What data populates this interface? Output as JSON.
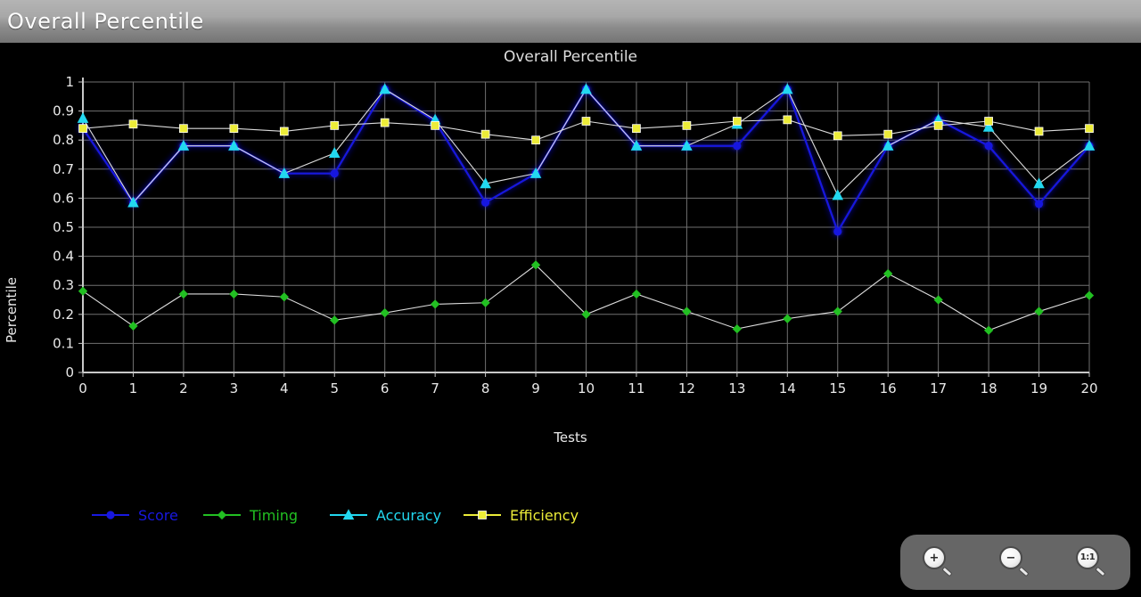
{
  "window": {
    "title": "Overall Percentile"
  },
  "chart_data": {
    "type": "line",
    "title": "Overall Percentile",
    "xlabel": "Tests",
    "ylabel": "Percentile",
    "grid": true,
    "legend_position": "bottom-left",
    "xlim": [
      0,
      20
    ],
    "ylim": [
      0,
      1
    ],
    "x": [
      0,
      1,
      2,
      3,
      4,
      5,
      6,
      7,
      8,
      9,
      10,
      11,
      12,
      13,
      14,
      15,
      16,
      17,
      18,
      19,
      20
    ],
    "x_ticks": [
      "0",
      "1",
      "2",
      "3",
      "4",
      "5",
      "6",
      "7",
      "8",
      "9",
      "10",
      "11",
      "12",
      "13",
      "14",
      "15",
      "16",
      "17",
      "18",
      "19",
      "20"
    ],
    "y_ticks": [
      "0",
      "0.1",
      "0.2",
      "0.3",
      "0.4",
      "0.5",
      "0.6",
      "0.7",
      "0.8",
      "0.9",
      "1"
    ],
    "y_tick_values": [
      0,
      0.1,
      0.2,
      0.3,
      0.4,
      0.5,
      0.6,
      0.7,
      0.8,
      0.9,
      1
    ],
    "series": [
      {
        "name": "Score",
        "color": "#1818e0",
        "marker": "circle",
        "values": [
          0.84,
          0.585,
          0.78,
          0.78,
          0.685,
          0.685,
          0.975,
          0.865,
          0.585,
          0.685,
          0.975,
          0.78,
          0.78,
          0.78,
          0.975,
          0.485,
          0.78,
          0.87,
          0.78,
          0.58,
          0.78
        ]
      },
      {
        "name": "Timing",
        "color": "#22c022",
        "marker": "diamond",
        "values": [
          0.28,
          0.16,
          0.27,
          0.27,
          0.26,
          0.18,
          0.205,
          0.235,
          0.24,
          0.37,
          0.2,
          0.27,
          0.21,
          0.15,
          0.185,
          0.21,
          0.34,
          0.25,
          0.145,
          0.21,
          0.265
        ]
      },
      {
        "name": "Accuracy",
        "color": "#22d8f0",
        "marker": "triangle",
        "values": [
          0.875,
          0.585,
          0.78,
          0.78,
          0.685,
          0.755,
          0.975,
          0.87,
          0.65,
          0.685,
          0.975,
          0.78,
          0.78,
          0.855,
          0.975,
          0.61,
          0.78,
          0.87,
          0.845,
          0.65,
          0.78
        ]
      },
      {
        "name": "Efficiency",
        "color": "#ecec38",
        "marker": "square",
        "values": [
          0.84,
          0.855,
          0.84,
          0.84,
          0.83,
          0.85,
          0.86,
          0.85,
          0.82,
          0.8,
          0.865,
          0.84,
          0.85,
          0.865,
          0.87,
          0.815,
          0.82,
          0.85,
          0.865,
          0.83,
          0.84
        ]
      }
    ]
  },
  "zoom_controls": {
    "zoom_in_label": "+",
    "zoom_out_label": "−",
    "reset_label": "1:1"
  }
}
